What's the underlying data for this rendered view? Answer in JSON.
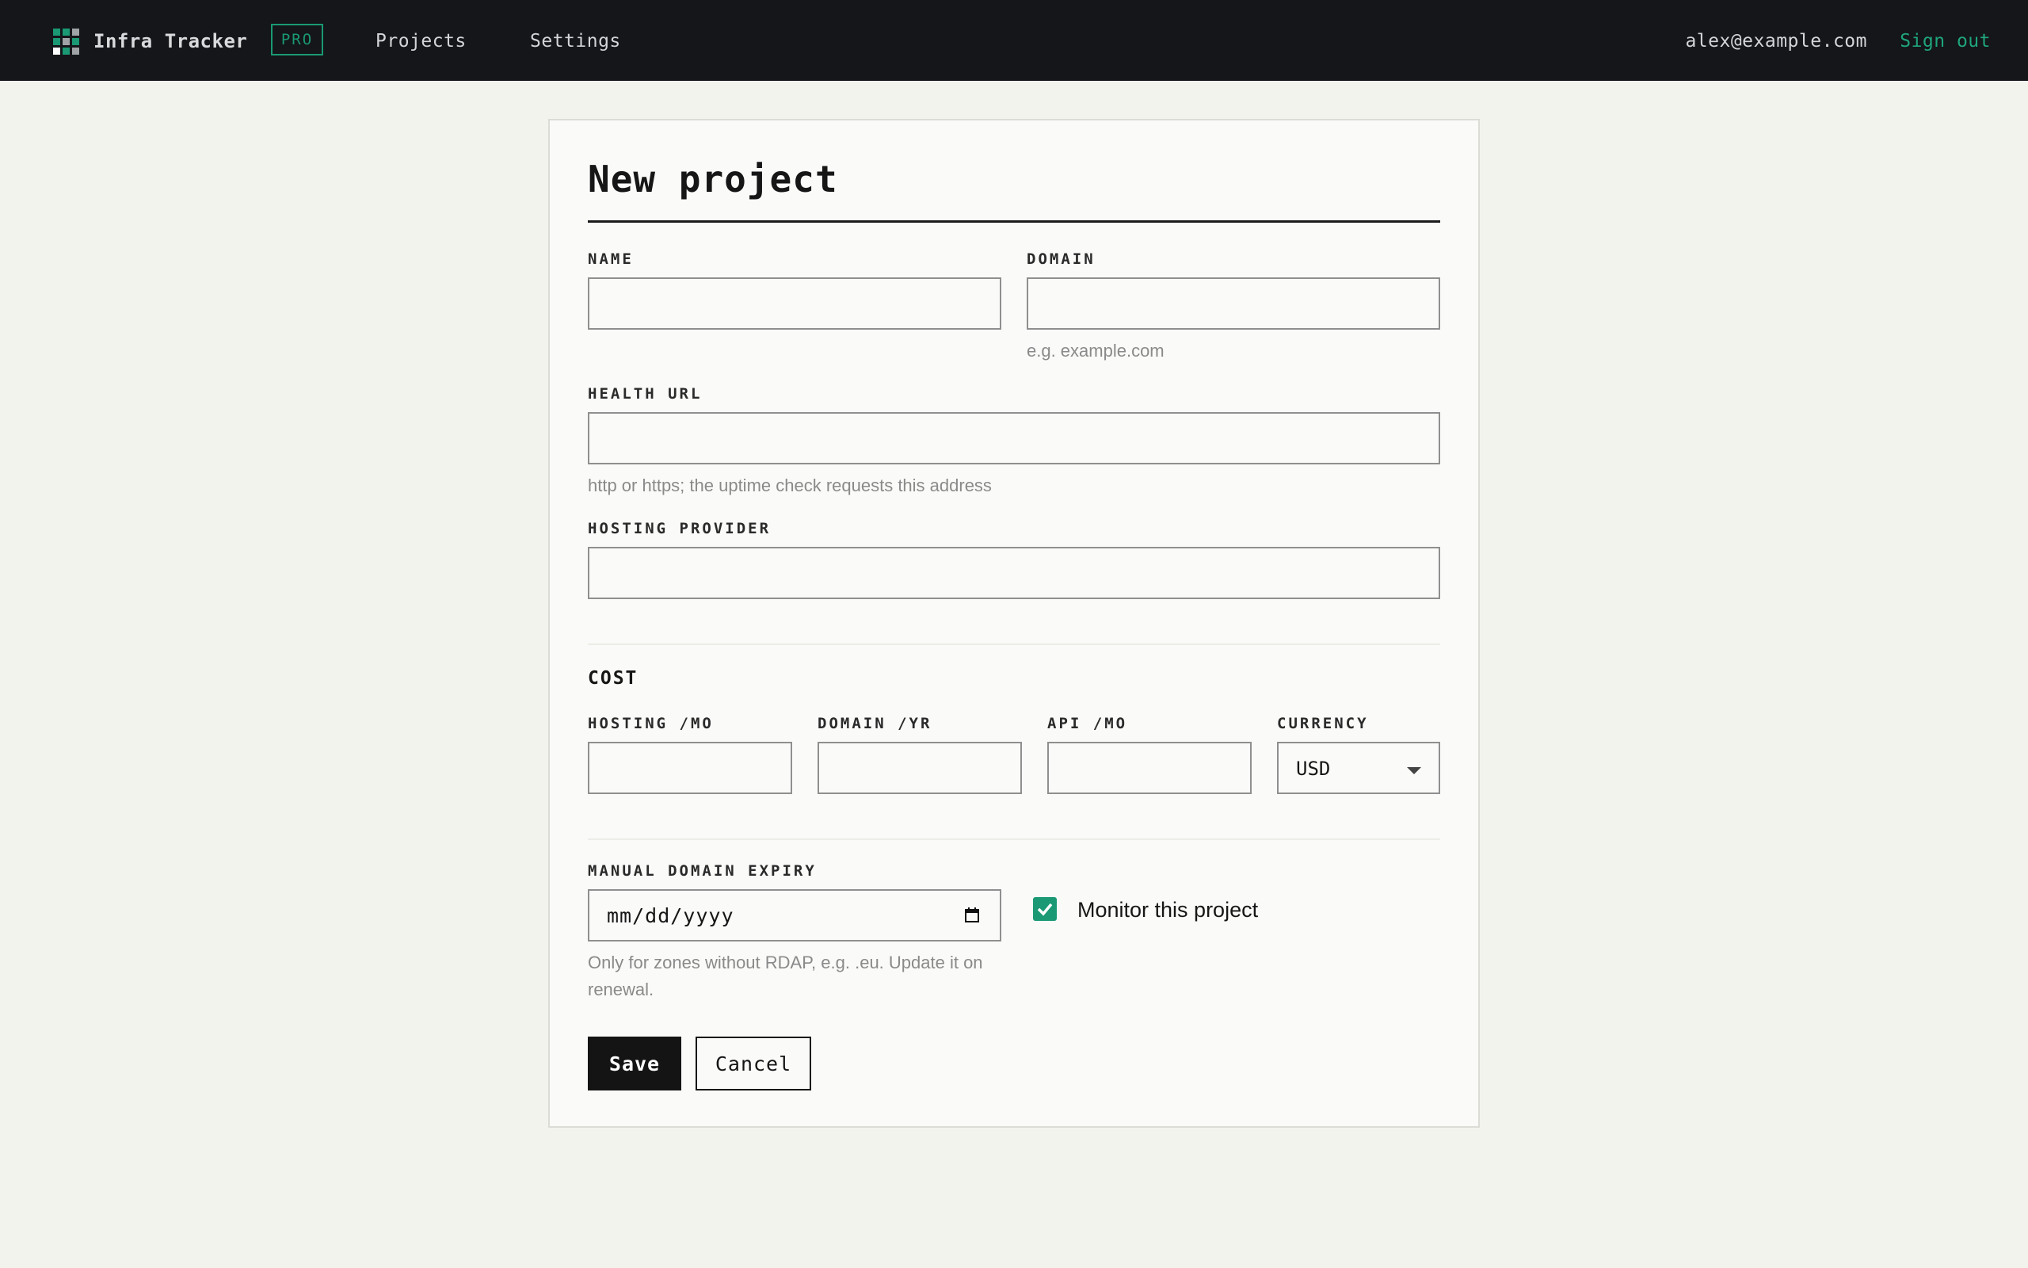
{
  "header": {
    "brand": "Infra Tracker",
    "badge": "PRO",
    "nav": [
      "Projects",
      "Settings"
    ],
    "user_email": "alex@example.com",
    "sign_out": "Sign out",
    "logo_icon": "grid-logo-icon"
  },
  "form": {
    "title": "New project",
    "fields": {
      "name": {
        "label": "NAME",
        "value": ""
      },
      "domain": {
        "label": "DOMAIN",
        "value": "",
        "hint": "e.g. example.com"
      },
      "health_url": {
        "label": "HEALTH URL",
        "value": "",
        "hint": "http or https; the uptime check requests this address"
      },
      "hosting_provider": {
        "label": "HOSTING PROVIDER",
        "value": ""
      }
    },
    "cost": {
      "title": "COST",
      "hosting": {
        "label": "HOSTING /MO",
        "value": ""
      },
      "domain": {
        "label": "DOMAIN /YR",
        "value": ""
      },
      "api": {
        "label": "API /MO",
        "value": ""
      },
      "currency": {
        "label": "CURRENCY",
        "value": "USD"
      }
    },
    "expiry": {
      "label": "MANUAL DOMAIN EXPIRY",
      "placeholder": "mm/dd/yyyy",
      "hint": "Only for zones without RDAP, e.g. .eu. Update it on renewal."
    },
    "monitor": {
      "label": "Monitor this project",
      "checked": true
    },
    "buttons": {
      "save": "Save",
      "cancel": "Cancel"
    }
  },
  "colors": {
    "accent": "#1a9974",
    "topbar": "#141619",
    "background": "#f3f3ee"
  }
}
